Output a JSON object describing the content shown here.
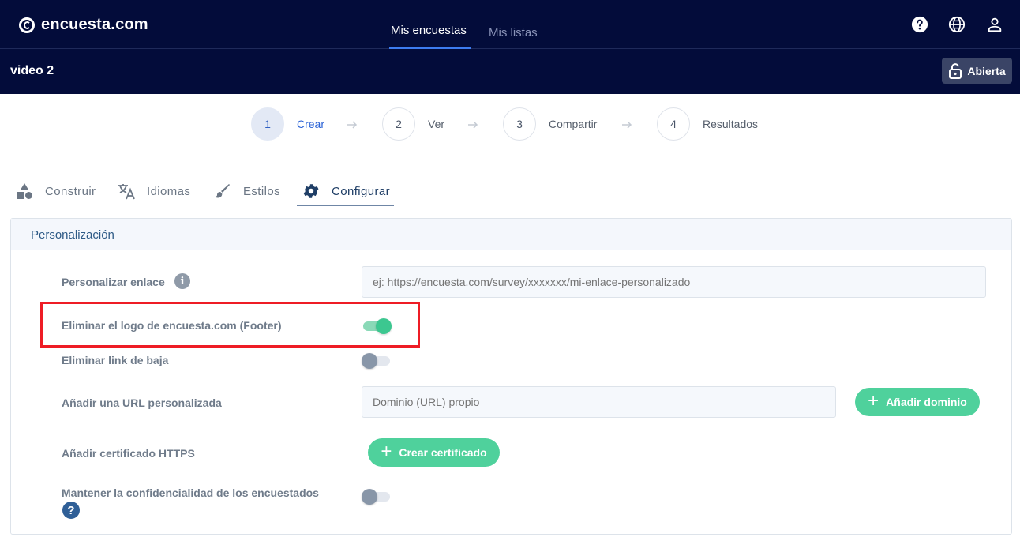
{
  "header": {
    "brand": "encuesta.com",
    "nav": [
      {
        "label": "Mis encuestas"
      },
      {
        "label": "Mis listas"
      }
    ]
  },
  "subbar": {
    "survey_title": "video 2",
    "status_label": "Abierta"
  },
  "stepper": [
    {
      "number": "1",
      "label": "Crear"
    },
    {
      "number": "2",
      "label": "Ver"
    },
    {
      "number": "3",
      "label": "Compartir"
    },
    {
      "number": "4",
      "label": "Resultados"
    }
  ],
  "section_tabs": [
    {
      "label": "Construir",
      "icon": "shapes-icon"
    },
    {
      "label": "Idiomas",
      "icon": "translate-icon"
    },
    {
      "label": "Estilos",
      "icon": "brush-icon"
    },
    {
      "label": "Configurar",
      "icon": "gear-icon"
    }
  ],
  "panel": {
    "title": "Personalización",
    "custom_link": {
      "label": "Personalizar enlace",
      "placeholder": "ej: https://encuesta.com/survey/xxxxxxx/mi-enlace-personalizado"
    },
    "remove_logo": {
      "label": "Eliminar el logo de encuesta.com (Footer)",
      "enabled": true
    },
    "remove_unsubscribe": {
      "label": "Eliminar link de baja",
      "enabled": false
    },
    "custom_url": {
      "label": "Añadir una URL personalizada",
      "placeholder": "Dominio (URL) propio",
      "button": "Añadir dominio"
    },
    "https_cert": {
      "label": "Añadir certificado HTTPS",
      "button": "Crear certificado"
    },
    "confidentiality": {
      "label": "Mantener la confidencialidad de los encuestados",
      "enabled": false
    }
  },
  "colors": {
    "navbar": "#030c3a",
    "accent_green": "#4fd19c",
    "highlight_red": "#ee1c25"
  }
}
